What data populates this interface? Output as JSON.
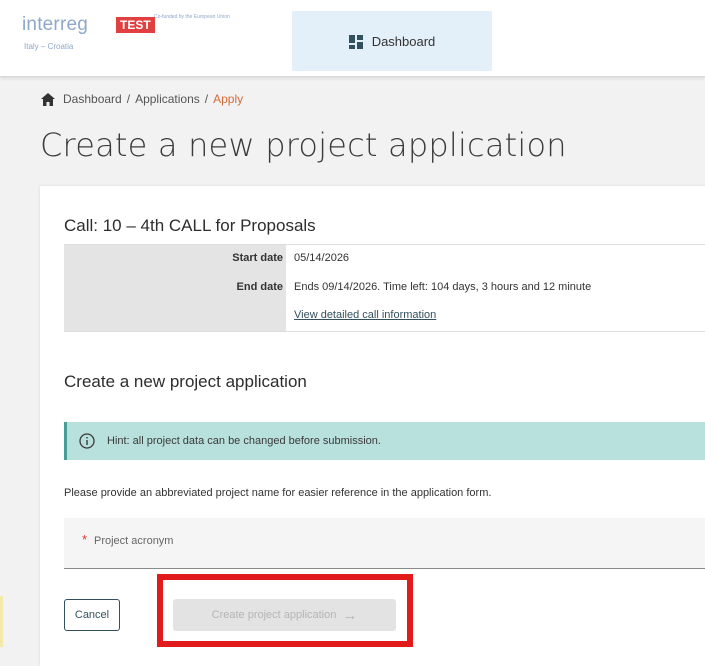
{
  "header": {
    "logo": {
      "main": "interreg",
      "badge": "TEST",
      "eu_text": "Co-funded by the European Union",
      "sub": "Italy – Croatia"
    },
    "nav_tab_label": "Dashboard"
  },
  "breadcrumb": {
    "items": [
      "Dashboard",
      "Applications",
      "Apply"
    ],
    "separator": "/"
  },
  "page_title": "Create a new project application",
  "call": {
    "title": "Call: 10 – 4th CALL for Proposals",
    "start_label": "Start date",
    "start_value": "05/14/2026",
    "end_label": "End date",
    "end_value": "Ends 09/14/2026. Time left: 104 days, 3 hours and 12 minute",
    "details_link": "View detailed call information"
  },
  "form": {
    "section_title": "Create a new project application",
    "hint": "Hint: all project data can be changed before submission.",
    "instruction": "Please provide an abbreviated project name for easier reference in the application form.",
    "acronym_required_marker": "*",
    "acronym_placeholder": "Project acronym",
    "cancel_label": "Cancel",
    "create_label": "Create project application"
  },
  "colors": {
    "accent": "#33505f",
    "breadcrumb_current": "#d16b3a",
    "hint_bg": "#b8e0dc",
    "highlight": "#e11b1b",
    "required": "#d9362b"
  },
  "icons": {
    "nav": "dashboard-icon",
    "breadcrumb": "home-icon",
    "hint": "info-icon",
    "create": "arrow-right-icon"
  }
}
